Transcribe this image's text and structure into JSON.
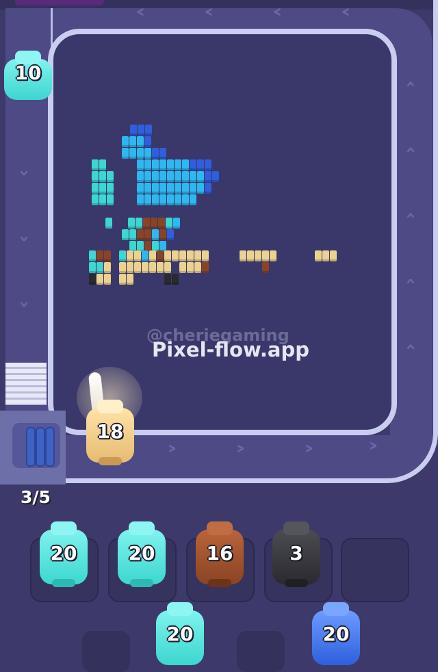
{
  "game": {
    "watermark_top": "@cheriegaming",
    "watermark_bottom": "Pixel-flow.app",
    "queue_counter": "3/5"
  },
  "conveyor": {
    "pig_on_track_top": {
      "count": "10",
      "color": "cyan"
    },
    "pig_on_track_bottom": {
      "count": "18",
      "color": "cream"
    }
  },
  "slots": [
    {
      "count": "20",
      "color": "cyan"
    },
    {
      "count": "20",
      "color": "cyan"
    },
    {
      "count": "16",
      "color": "brown"
    },
    {
      "count": "3",
      "color": "black"
    },
    {
      "count": "",
      "color": "empty"
    }
  ],
  "queue": [
    {
      "count": "20",
      "color": "cyan"
    },
    {
      "count": "20",
      "color": "blue"
    }
  ],
  "colors": {
    "cyan": "#3dd6d0",
    "sky": "#2fb8ef",
    "blue": "#2f5fdc",
    "brown": "#8a4424",
    "cream": "#ecd28f",
    "black": "#2a2a30",
    "track": "#4e4a86",
    "wall": "#c9cdf0"
  }
}
